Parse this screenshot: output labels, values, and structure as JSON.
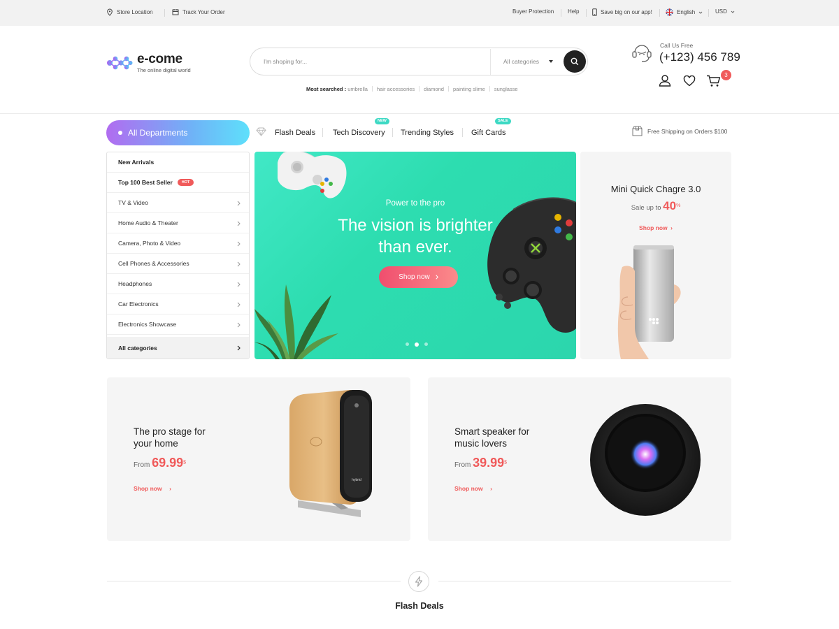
{
  "topbar": {
    "store_location": "Store Location",
    "track_order": "Track Your Order",
    "buyer_protection": "Buyer Protection",
    "help": "Help",
    "app_promo": "Save big on our app!",
    "language": "English",
    "currency": "USD"
  },
  "header": {
    "logo_name": "e-come",
    "logo_tagline": "The online digital world",
    "search_placeholder": "I'm shoping for...",
    "category_select": "All categories",
    "most_searched_label": "Most searched :",
    "most_searched": [
      "umbrella",
      "hair accessories",
      "diamond",
      "painting slime",
      "sunglasse"
    ],
    "call_label": "Call Us Free",
    "phone": "(+123) 456 789",
    "cart_count": "3"
  },
  "nav": {
    "all_departments": "All Departments",
    "links": [
      "Flash Deals",
      "Tech Discovery",
      "Trending Styles",
      "Gift Cards"
    ],
    "badge_new": "NEW",
    "badge_sale": "SALE",
    "shipping": "Free Shipping on Orders $100"
  },
  "sidebar": {
    "items": [
      "New Arrivals",
      "Top 100 Best Seller",
      "TV & Video",
      "Home Audio & Theater",
      "Camera, Photo & Video",
      "Cell Phones & Accessories",
      "Headphones",
      "Car Electronics",
      "Electronics Showcase"
    ],
    "hot_badge": "HOT",
    "all_categories": "All categories"
  },
  "hero": {
    "subtitle": "Power to the pro",
    "title_line1": "The vision is brighter",
    "title_line2": "than ever.",
    "button": "Shop now",
    "active_slide": 2,
    "slide_count": 3
  },
  "promo": {
    "title": "Mini Quick Chagre 3.0",
    "sale_prefix": "Sale up to",
    "sale_value": "40",
    "sale_unit": "%",
    "shop_now": "Shop now"
  },
  "banners": [
    {
      "title_line1": "The pro stage for",
      "title_line2": "your home",
      "from": "From",
      "price": "69.99",
      "currency": "$",
      "shop_now": "Shop now",
      "device_text": "hybrid"
    },
    {
      "title_line1": "Smart speaker for",
      "title_line2": "music lovers",
      "from": "From",
      "price": "39.99",
      "currency": "$",
      "shop_now": "Shop now"
    }
  ],
  "flash_deals": {
    "title": "Flash Deals"
  },
  "colors": {
    "accent": "#f05a5a",
    "teal": "#2ddbb2",
    "gradient_start": "#b16cf0",
    "gradient_end": "#5ee0fb",
    "dark": "#222222"
  }
}
